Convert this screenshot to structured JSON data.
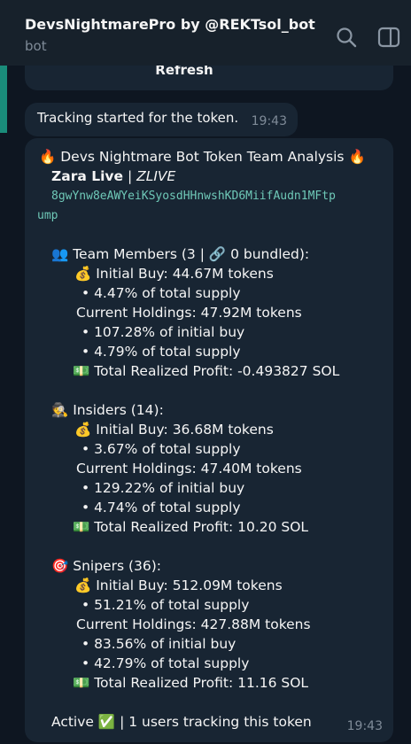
{
  "header": {
    "title": "DevsNightmarePro by @REKTsol_bot",
    "subtitle": "bot"
  },
  "icons": {
    "search": "search-icon",
    "sidebar": "sidebar-toggle-icon"
  },
  "messages": {
    "refresh_label": "Refresh",
    "tracking": {
      "text": "Tracking started for the token.",
      "time": "19:43"
    },
    "analysis": {
      "header": "🔥 Devs Nightmare Bot Token Team Analysis 🔥",
      "token_name": "Zara Live",
      "token_symbol": "ZLIVE",
      "address_line1": "8gwYnw8eAWYeiKSyosdHHnwshKD6MiifAudn1MFtp",
      "address_line2": "ump",
      "team": {
        "title": "👥 Team Members (3 | 🔗 0 bundled):",
        "initial_buy": "💰 Initial Buy: 44.67M tokens",
        "initial_pct": "• 4.47% of total supply",
        "holdings": "Current Holdings: 47.92M tokens",
        "holdings_pct_initial": "• 107.28% of initial buy",
        "holdings_pct_supply": "• 4.79% of total supply",
        "profit": "💵 Total Realized Profit: -0.493827 SOL"
      },
      "insiders": {
        "title": "🕵 Insiders (14):",
        "initial_buy": "💰 Initial Buy: 36.68M tokens",
        "initial_pct": "• 3.67% of total supply",
        "holdings": "Current Holdings: 47.40M tokens",
        "holdings_pct_initial": "• 129.22% of initial buy",
        "holdings_pct_supply": "• 4.74% of total supply",
        "profit": "💵 Total Realized Profit: 10.20 SOL"
      },
      "snipers": {
        "title": "🎯 Snipers (36):",
        "initial_buy": "💰 Initial Buy: 512.09M tokens",
        "initial_pct": "• 51.21% of total supply",
        "holdings": "Current Holdings: 427.88M tokens",
        "holdings_pct_initial": "• 83.56% of initial buy",
        "holdings_pct_supply": "• 42.79% of total supply",
        "profit": "💵 Total Realized Profit: 11.16 SOL"
      },
      "footer": "Active ✅ | 1 users tracking this token",
      "time": "19:43"
    }
  }
}
